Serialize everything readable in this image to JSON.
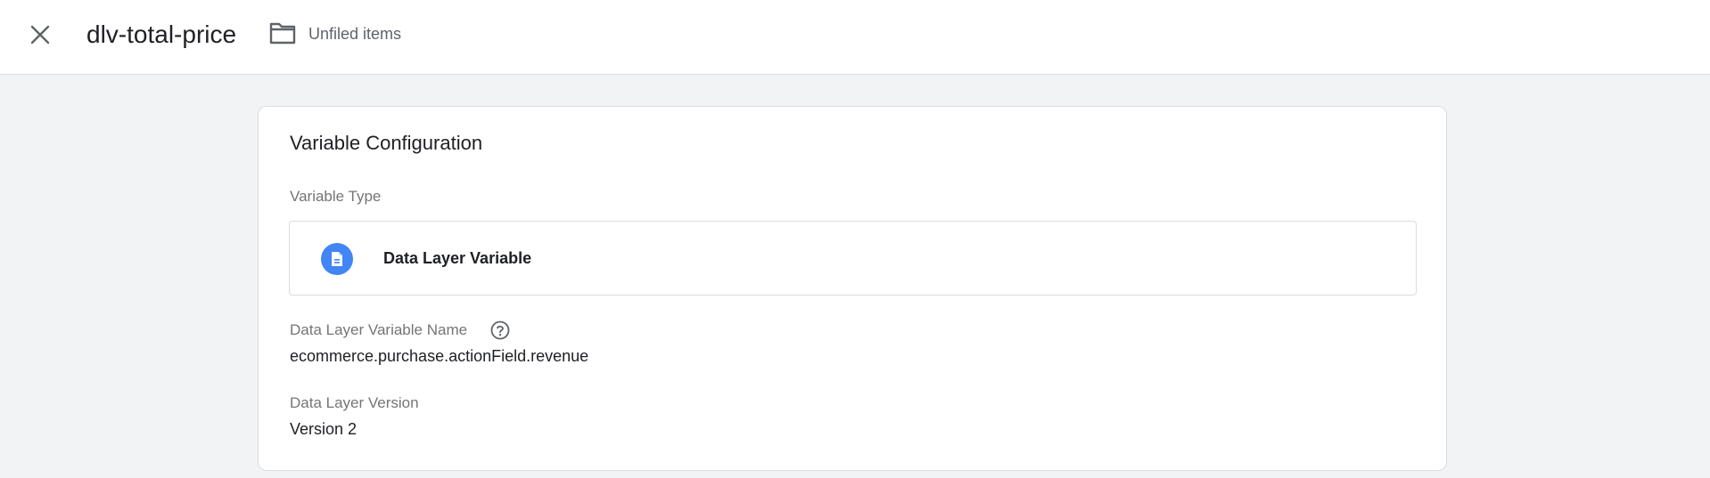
{
  "header": {
    "title": "dlv-total-price",
    "folder_label": "Unfiled items",
    "close_icon": "close-icon",
    "folder_icon": "folder-icon"
  },
  "card": {
    "title": "Variable Configuration",
    "variable_type": {
      "label": "Variable Type",
      "name": "Data Layer Variable",
      "icon": "document-icon",
      "icon_color": "#4285f4"
    },
    "variable_name": {
      "label": "Data Layer Variable Name",
      "value": "ecommerce.purchase.actionField.revenue",
      "help_icon": "help-icon"
    },
    "version": {
      "label": "Data Layer Version",
      "value": "Version 2"
    }
  }
}
